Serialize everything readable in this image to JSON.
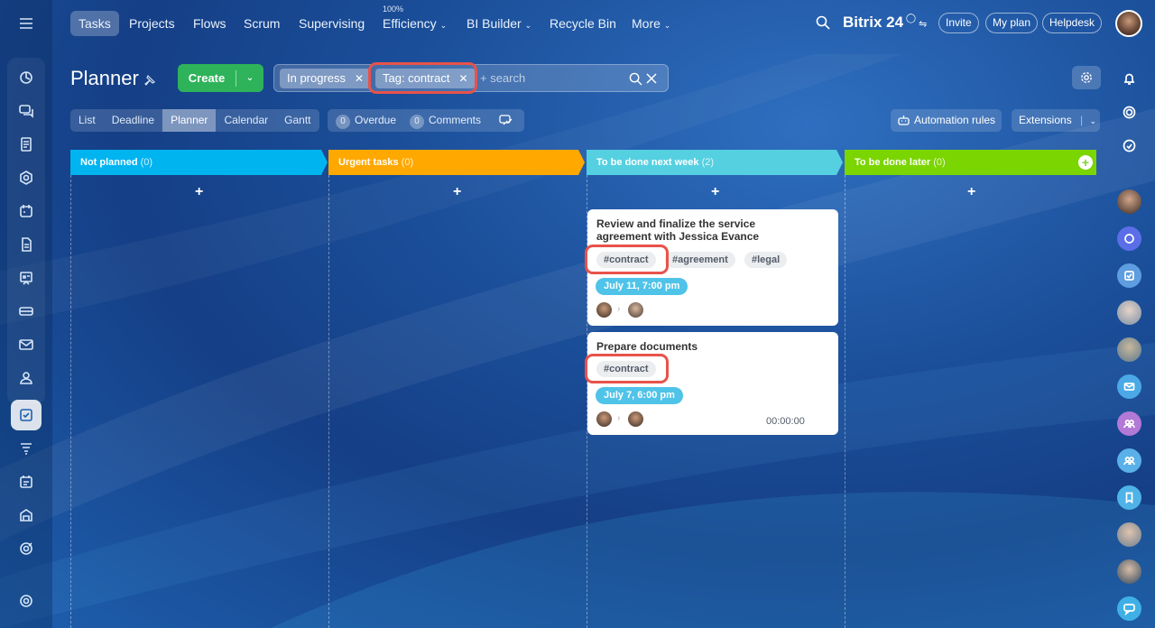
{
  "topnav": {
    "items": [
      "Tasks",
      "Projects",
      "Flows",
      "Scrum",
      "Supervising",
      "Efficiency",
      "BI Builder",
      "Recycle Bin",
      "More"
    ],
    "efficiency_sup": "100%",
    "brand": "Bitrix 24",
    "invite": "Invite",
    "my_plan": "My plan",
    "helpdesk": "Helpdesk"
  },
  "page": {
    "title": "Planner",
    "create_label": "Create"
  },
  "filter": {
    "chips": [
      "In progress",
      "Tag: contract"
    ],
    "search_placeholder": "+ search"
  },
  "views": {
    "tabs": [
      "List",
      "Deadline",
      "Planner",
      "Calendar",
      "Gantt"
    ],
    "active": "Planner"
  },
  "counters": {
    "overdue_count": "0",
    "overdue_label": "Overdue",
    "comments_count": "0",
    "comments_label": "Comments"
  },
  "toolbar": {
    "automation_rules": "Automation rules",
    "extensions": "Extensions"
  },
  "columns": [
    {
      "title": "Not planned",
      "count": "(0)",
      "color": "#00b4f0"
    },
    {
      "title": "Urgent tasks",
      "count": "(0)",
      "color": "#ffa800"
    },
    {
      "title": "To be done next week",
      "count": "(2)",
      "color": "#55d0e0"
    },
    {
      "title": "To be done later",
      "count": "(0)",
      "color": "#7bd500"
    }
  ],
  "cards": [
    {
      "title": "Review and finalize the service agreement with Jessica Evance",
      "tags": [
        "#contract",
        "#agreement",
        "#legal"
      ],
      "deadline": "July 11, 7:00 pm"
    },
    {
      "title": "Prepare documents",
      "tags": [
        "#contract"
      ],
      "deadline": "July 7, 6:00 pm",
      "timer": "00:00:00"
    }
  ],
  "colors": {
    "highlight": "#e8524a",
    "create_green": "#2fb35a",
    "deadline_blue": "#4fc3e8"
  }
}
